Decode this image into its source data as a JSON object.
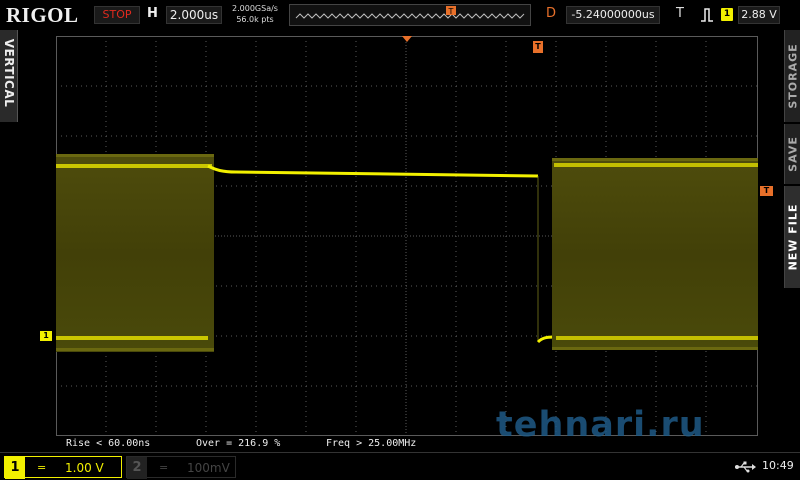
{
  "brand": "RIGOL",
  "colors": {
    "ch1": "#f2f000",
    "ch2": "#00e5ff",
    "trigger": "#e8702a",
    "run_stop": "#e02a1e",
    "grid": "#6a6a6a"
  },
  "top_bar": {
    "run_state": "STOP",
    "horizontal": {
      "label": "H",
      "value": "2.000us"
    },
    "sample_rate": "2.000GSa/s",
    "memory_depth": "56.0k pts",
    "delay": {
      "label": "D",
      "value": "-5.24000000us"
    },
    "trigger": {
      "label": "T",
      "edge_icon": "rising-edge-icon",
      "source_badge": "1",
      "level": "2.88 V"
    }
  },
  "side_tabs": {
    "left": "VERTICAL",
    "right": [
      "STORAGE",
      "SAVE",
      "NEW FILE"
    ]
  },
  "markers": {
    "ch1": "1",
    "trigger_level": "T",
    "trigger_position": "T",
    "horizontal_position": "T"
  },
  "measurements": [
    {
      "label": "Rise < 60.00ns"
    },
    {
      "label": "Over = 216.9 %"
    },
    {
      "label": "Freq > 25.00MHz"
    }
  ],
  "channels": [
    {
      "num": "1",
      "coupling": "=",
      "scale": "1.00 V",
      "active": true
    },
    {
      "num": "2",
      "coupling": "=",
      "scale": "100mV",
      "active": false
    }
  ],
  "status": {
    "usb_icon": "usb-icon",
    "time": "10:49"
  },
  "watermark": "tehnari.ru"
}
